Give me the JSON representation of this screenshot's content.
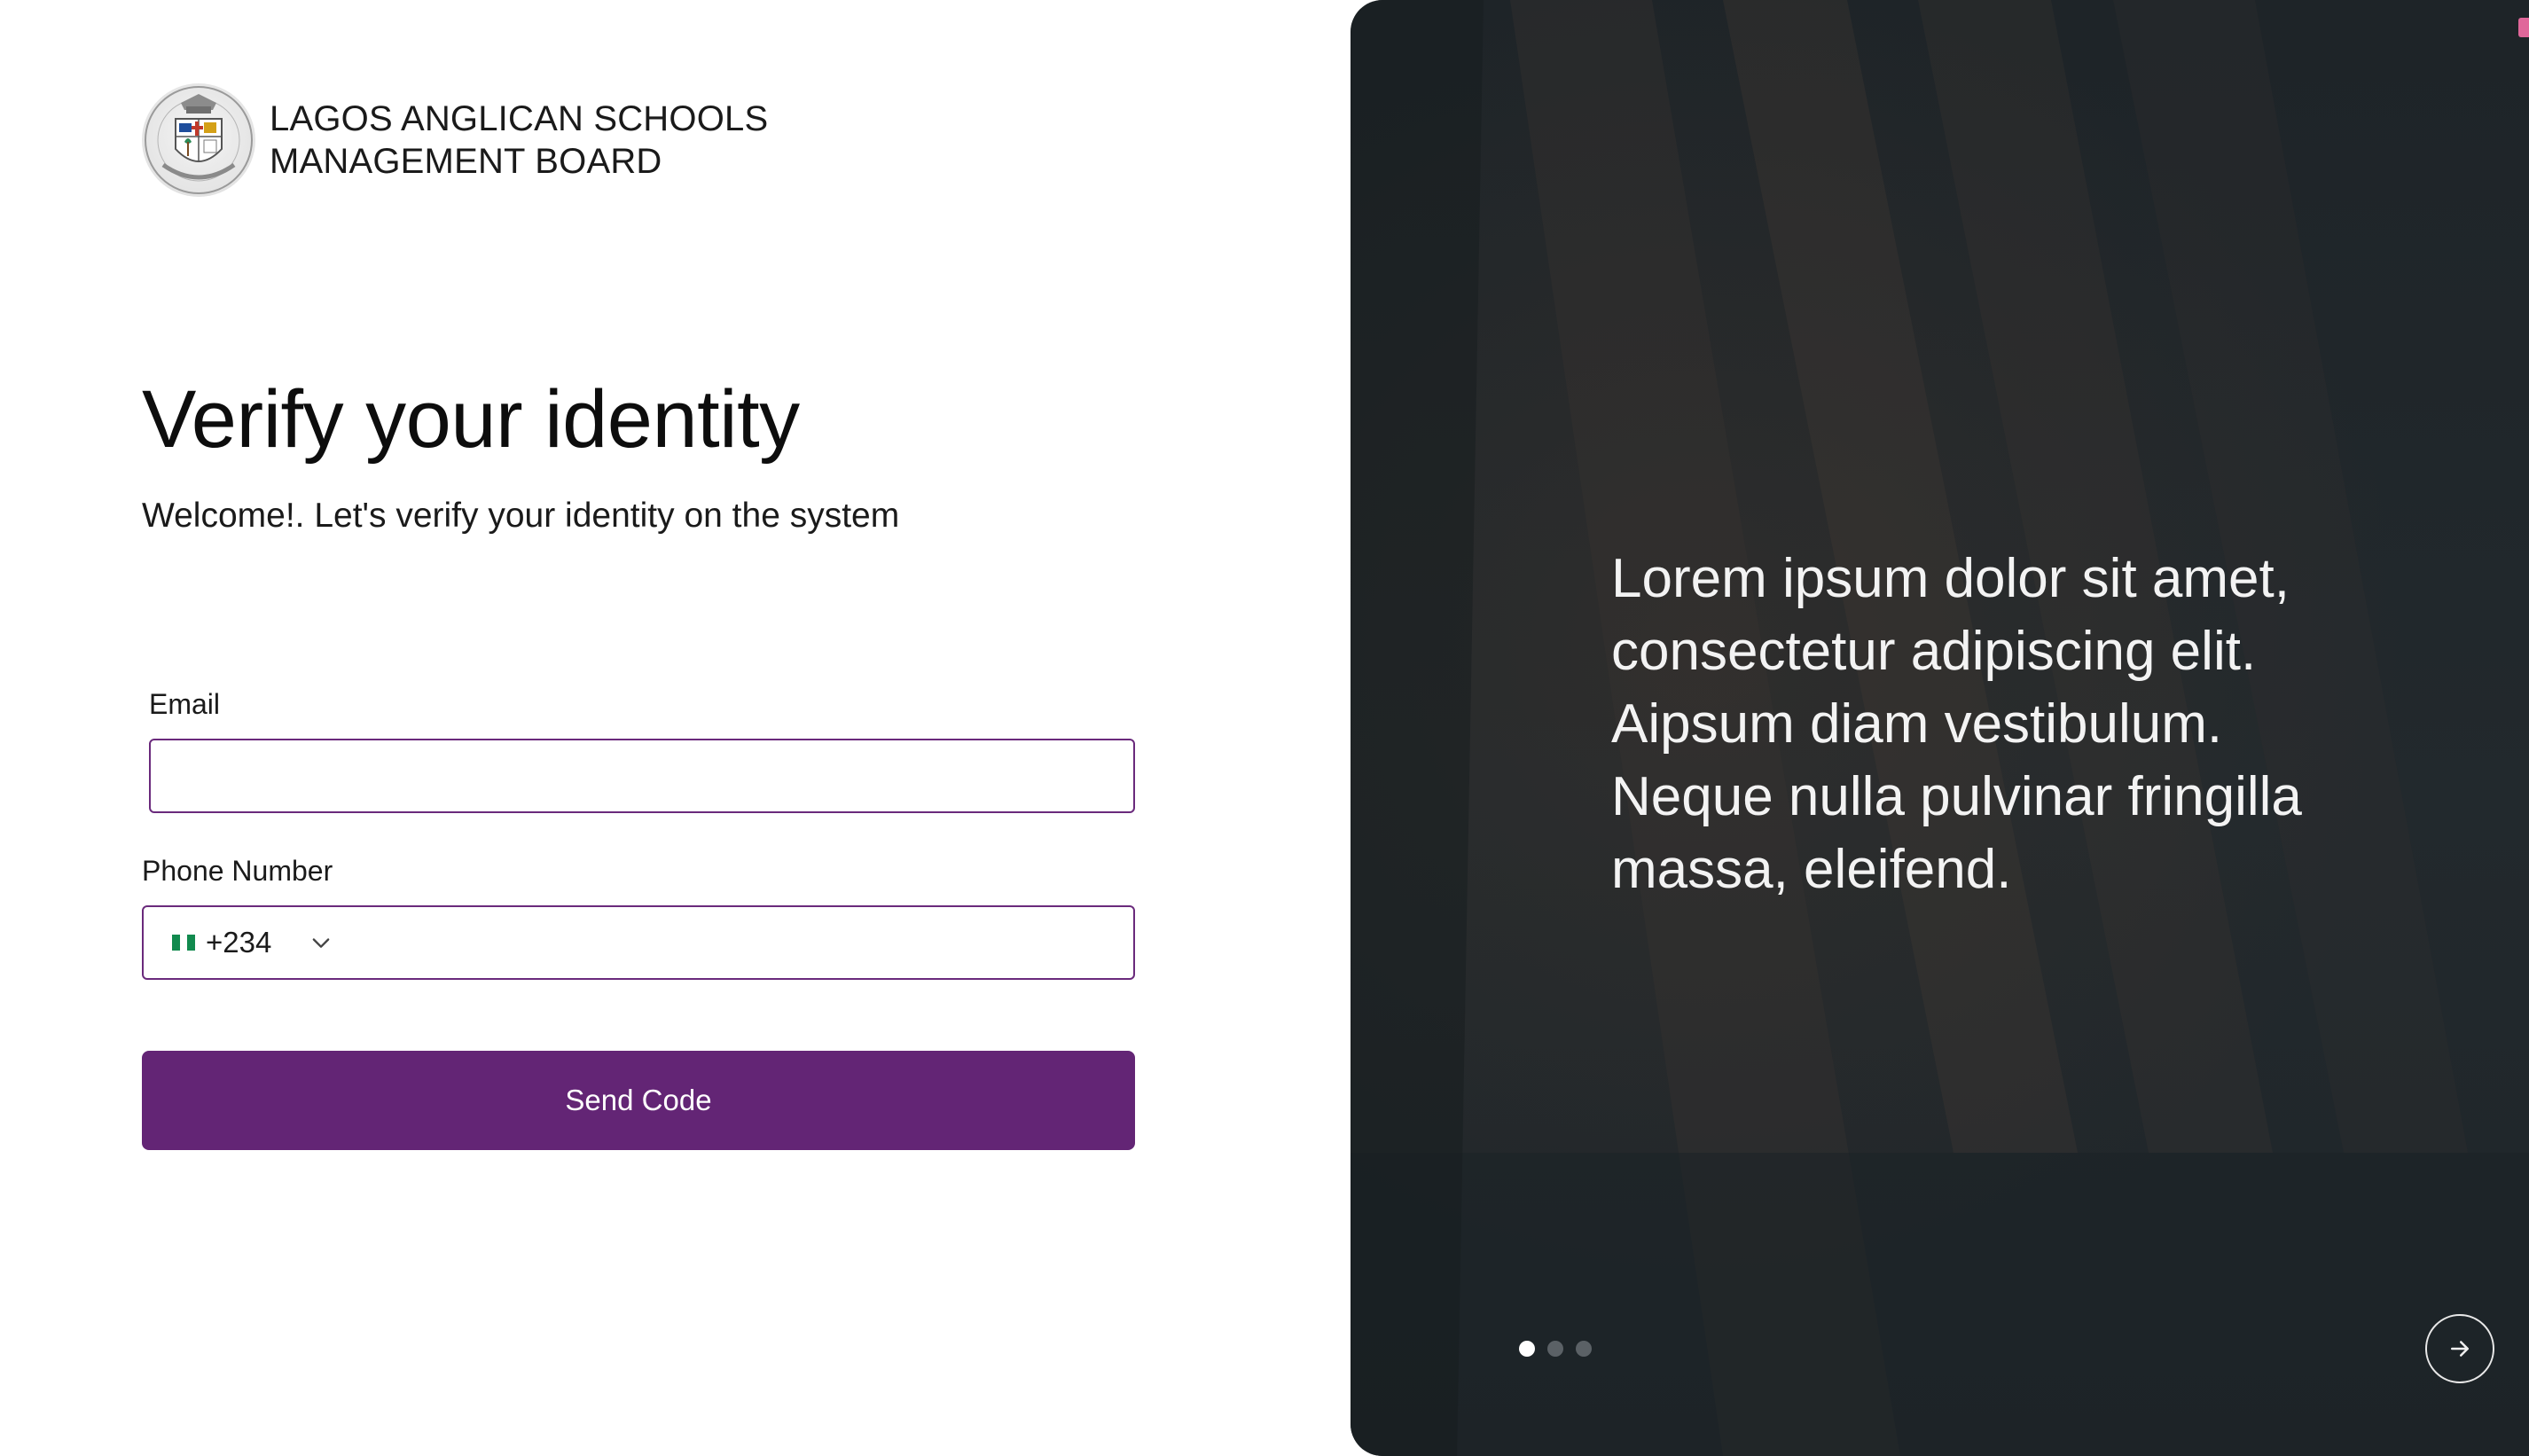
{
  "brand": {
    "name_line1": "LAGOS ANGLICAN SCHOOLS",
    "name_line2": "MANAGEMENT BOARD",
    "logo_icon": "school-crest-logo"
  },
  "form": {
    "title": "Verify your identity",
    "subtitle": "Welcome!. Let's verify your identity on the system",
    "email_label": "Email",
    "email_value": "",
    "phone_label": "Phone Number",
    "phone_value": "",
    "country_flag": "nigeria-flag-icon",
    "country_dial_code": "+234",
    "submit_label": "Send Code"
  },
  "carousel": {
    "quote": "Lorem ipsum dolor sit amet, consectetur adipiscing elit. Aipsum diam vestibulum. Neque nulla pulvinar fringilla massa, eleifend.",
    "slide_count": 3,
    "active_slide": 1,
    "next_icon": "arrow-right-icon"
  },
  "colors": {
    "accent": "#632575",
    "input_border": "#6a2a7c",
    "panel_bg": "#22292d",
    "text": "#111111"
  }
}
